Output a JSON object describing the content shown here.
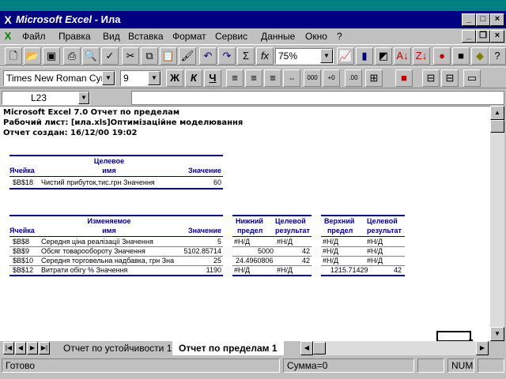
{
  "window": {
    "title_app": "Microsoft Excel",
    "title_sep": " - ",
    "title_doc": "Ила",
    "btn_min": "_",
    "btn_max": "□",
    "btn_close": "×",
    "doc_btn_min": "_",
    "doc_btn_restore": "❐",
    "doc_btn_close": "×"
  },
  "menu": {
    "items": [
      "Файл",
      "Правка",
      "Вид",
      "Вставка",
      "Формат",
      "Сервис",
      "Данные",
      "Окно",
      "?"
    ]
  },
  "toolbar_standard": {
    "zoom": "75%"
  },
  "toolbar_format": {
    "font": "Times New Roman Cyr",
    "size": "9",
    "bold": "Ж",
    "italic": "К",
    "underline": "Ч"
  },
  "formula_bar": {
    "name_box": "L23",
    "formula": ""
  },
  "report": {
    "line1": "Microsoft Excel 7.0 Отчет по пределам",
    "line2": "Рабочий лист: [ила.xls]Оптимізаційне моделювання",
    "line3": "Отчет создан: 16/12/00 19:02",
    "target": {
      "hdr_cell": "Ячейка",
      "hdr_name_top": "Целевое",
      "hdr_name": "имя",
      "hdr_value": "Значение",
      "row": {
        "cell": "$B$18",
        "name": "Чистий прибуток,тис.грн Значення",
        "value": "60"
      }
    },
    "changing": {
      "hdr_cell": "Ячейка",
      "hdr_name_top": "Изменяемое",
      "hdr_name": "имя",
      "hdr_value": "Значение",
      "hdr_lower_top": "Нижний",
      "hdr_lower": "предел",
      "hdr_result1_top": "Целевой",
      "hdr_result1": "результат",
      "hdr_upper_top": "Верхний",
      "hdr_upper": "предел",
      "hdr_result2_top": "Целевой",
      "hdr_result2": "результат",
      "rows": [
        {
          "cell": "$B$8",
          "name": "Середня ціна реалізації Значення",
          "value": "5",
          "lower": "#Н/Д",
          "res1": "#Н/Д",
          "upper": "#Н/Д",
          "res2": "#Н/Д"
        },
        {
          "cell": "$B$9",
          "name": "Обсяг товарообороту Значення",
          "value": "5102.85714",
          "lower": "5000",
          "res1": "42",
          "upper": "#Н/Д",
          "res2": "#Н/Д"
        },
        {
          "cell": "$B$10",
          "name": "Середня торговельна надбавка, грн Зна",
          "value": "25",
          "lower": "24.4960806",
          "res1": "42",
          "upper": "#Н/Д",
          "res2": "#Н/Д"
        },
        {
          "cell": "$B$12",
          "name": "Витрати обігу % Значення",
          "value": "1190",
          "lower": "#Н/Д",
          "res1": "#Н/Д",
          "upper": "1215.71429",
          "res2": "42"
        }
      ]
    }
  },
  "sheet_tabs": {
    "tab1": "Отчет по устойчивости 1",
    "tab2": "Отчет по пределам 1"
  },
  "status": {
    "ready": "Готово",
    "sum": "Сумма=0",
    "num": "NUM"
  }
}
